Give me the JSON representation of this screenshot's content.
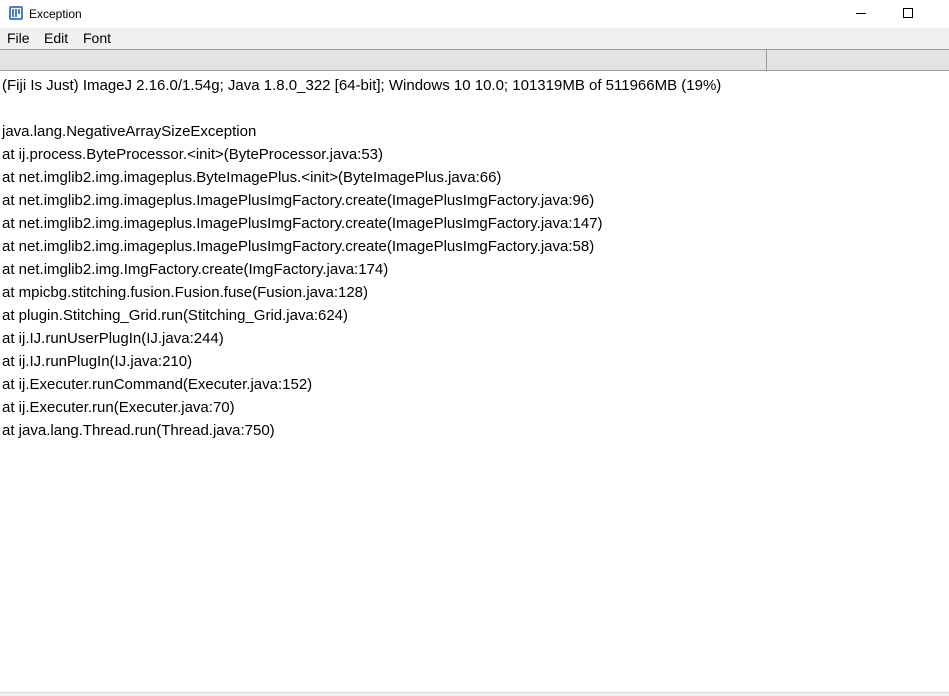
{
  "window": {
    "title": "Exception",
    "app_icon": "imagej-app-icon",
    "controls": {
      "minimize_icon": "minimize-icon",
      "maximize_icon": "maximize-icon"
    }
  },
  "menu": {
    "file": "File",
    "edit": "Edit",
    "font": "Font"
  },
  "content": {
    "header_line": "(Fiji Is Just) ImageJ 2.16.0/1.54g; Java 1.8.0_322 [64-bit]; Windows 10 10.0; 101319MB of 511966MB (19%)",
    "exception": "java.lang.NegativeArraySizeException",
    "stack": [
      "at ij.process.ByteProcessor.<init>(ByteProcessor.java:53)",
      "at net.imglib2.img.imageplus.ByteImagePlus.<init>(ByteImagePlus.java:66)",
      "at net.imglib2.img.imageplus.ImagePlusImgFactory.create(ImagePlusImgFactory.java:96)",
      "at net.imglib2.img.imageplus.ImagePlusImgFactory.create(ImagePlusImgFactory.java:147)",
      "at net.imglib2.img.imageplus.ImagePlusImgFactory.create(ImagePlusImgFactory.java:58)",
      "at net.imglib2.img.ImgFactory.create(ImgFactory.java:174)",
      "at mpicbg.stitching.fusion.Fusion.fuse(Fusion.java:128)",
      "at plugin.Stitching_Grid.run(Stitching_Grid.java:624)",
      "at ij.IJ.runUserPlugIn(IJ.java:244)",
      "at ij.IJ.runPlugIn(IJ.java:210)",
      "at ij.Executer.runCommand(Executer.java:152)",
      "at ij.Executer.run(Executer.java:70)",
      "at java.lang.Thread.run(Thread.java:750)"
    ]
  }
}
